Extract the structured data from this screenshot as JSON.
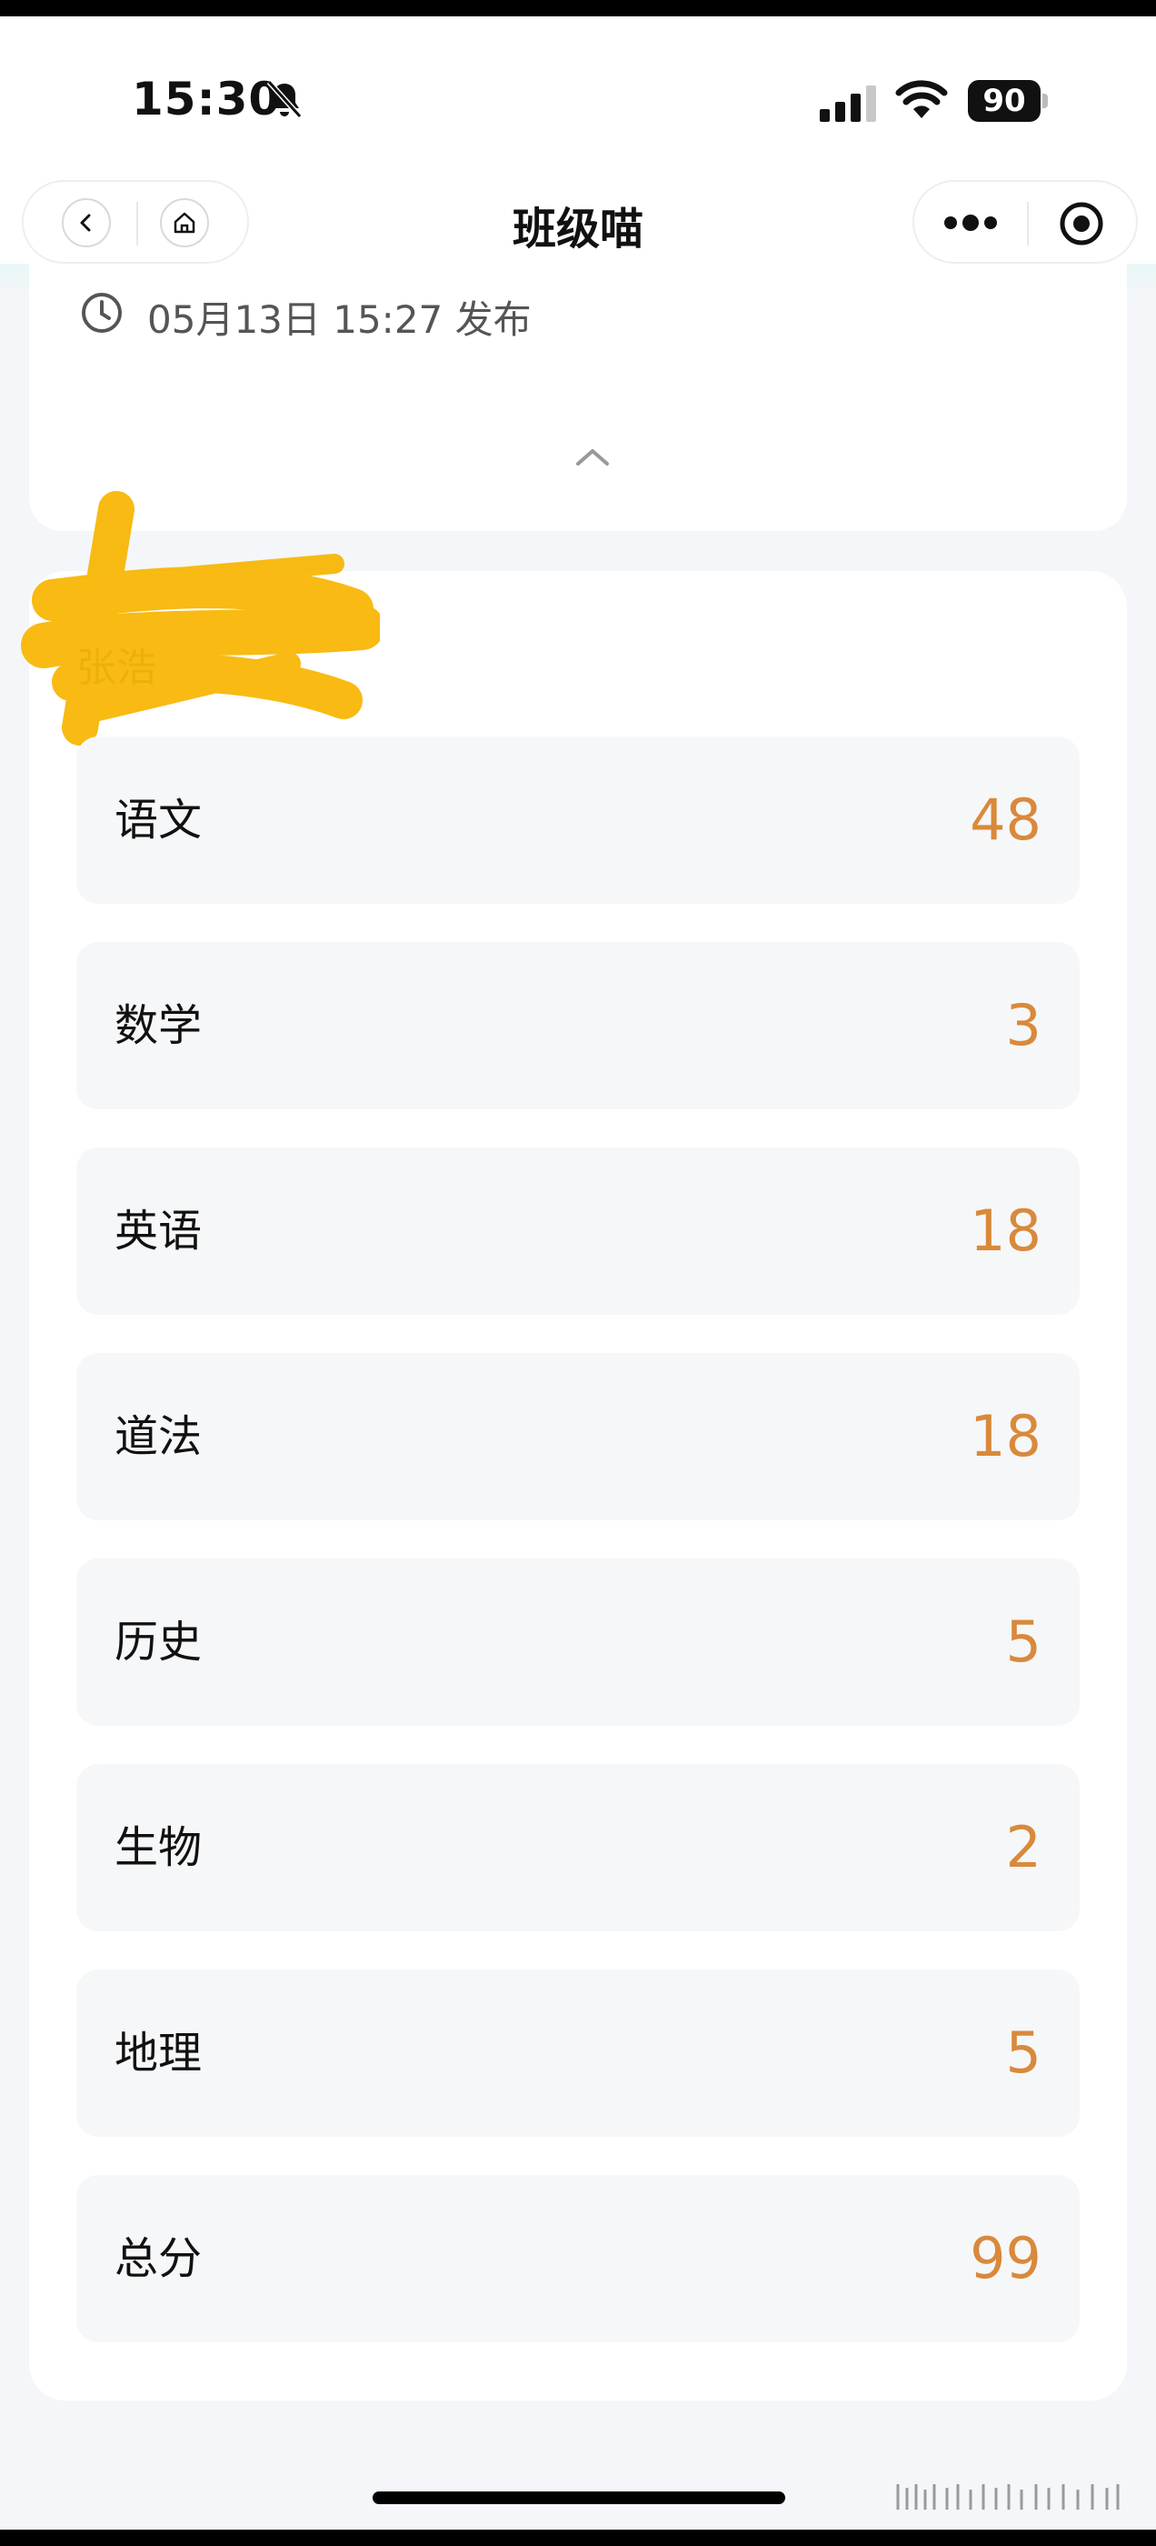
{
  "status_bar": {
    "time": "15:30",
    "battery": "90"
  },
  "nav": {
    "title": "班级喵"
  },
  "notice": {
    "publish_time": "05月13日 15:27 发布"
  },
  "student": {
    "name": "张浩"
  },
  "scores": [
    {
      "subject": "语文",
      "score": "48"
    },
    {
      "subject": "数学",
      "score": "3"
    },
    {
      "subject": "英语",
      "score": "18"
    },
    {
      "subject": "道法",
      "score": "18"
    },
    {
      "subject": "历史",
      "score": "5"
    },
    {
      "subject": "生物",
      "score": "2"
    },
    {
      "subject": "地理",
      "score": "5"
    },
    {
      "subject": "总分",
      "score": "99"
    }
  ],
  "colors": {
    "score": "#d9893b",
    "card": "#ffffff",
    "row": "#f6f7f9",
    "background": "#f4f6f9",
    "scribble": "#f8b500"
  },
  "icons": [
    "bell-slash-icon",
    "signal-icon",
    "wifi-icon",
    "back-icon",
    "home-icon",
    "more-icon",
    "target-icon",
    "clock-icon",
    "chevron-up-icon"
  ]
}
